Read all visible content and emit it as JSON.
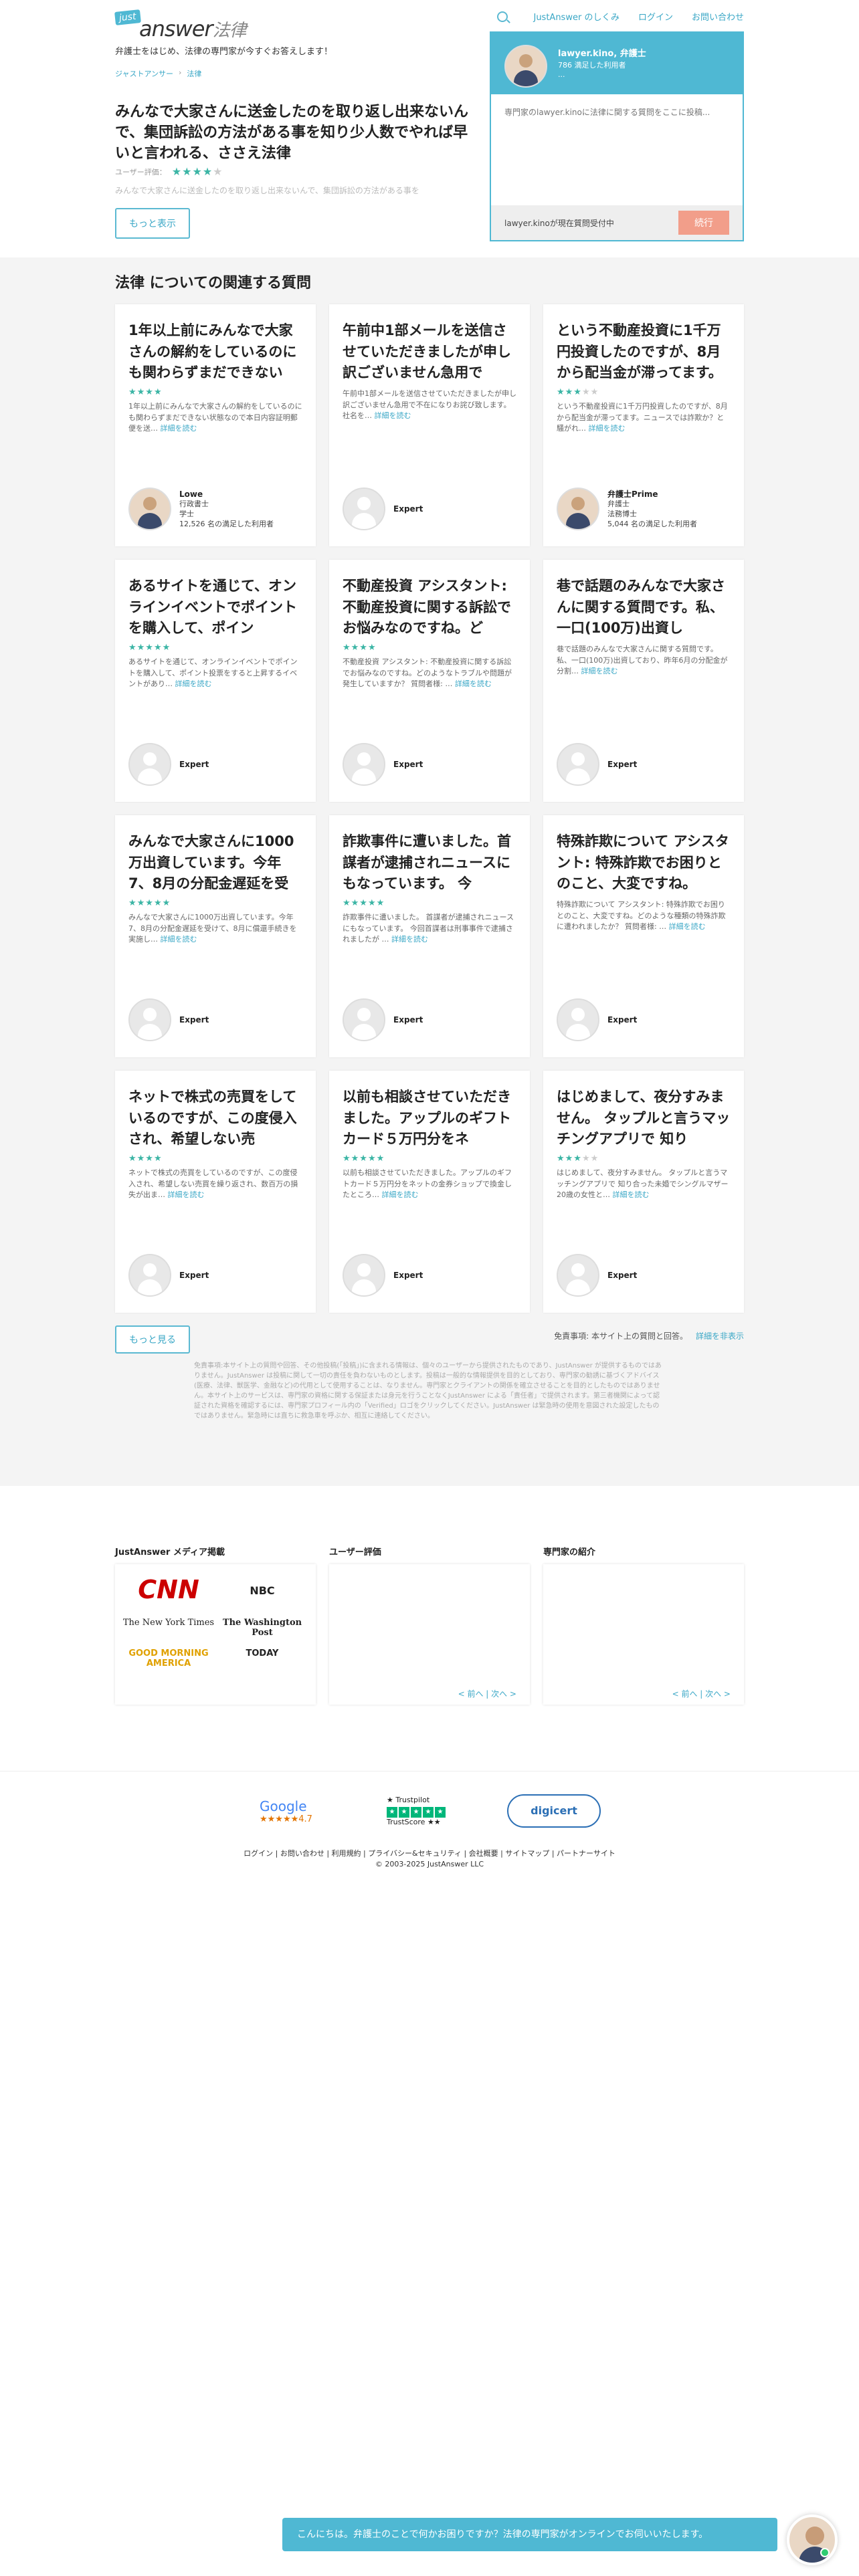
{
  "header": {
    "logo_just": "just",
    "logo_answer": "answer",
    "logo_sub": "法律",
    "tagline": "弁護士をはじめ、法律の専門家が今すぐお答えします！",
    "nav": [
      "JustAnswer のしくみ",
      "ログイン",
      "お問い合わせ"
    ]
  },
  "breadcrumb": [
    "ジャストアンサー",
    "法律"
  ],
  "question": {
    "title": "みんなで大家さんに送金したのを取り返し出来ないんで、集団訴訟の方法がある事を知り少人数でやれば早いと言われる、ささえ法律",
    "rating_label": "ユーザー評価：",
    "stars_on": "★★★★",
    "stars_off": "★",
    "preview": "みんなで大家さんに送金したのを取り返し出来ないんで、集団訴訟の方法がある事を",
    "more_button": "もっと表示"
  },
  "chat_widget": {
    "expert_name": "lawyer.kino, 弁護士",
    "satisfied": "786 満足した利用者",
    "dots": "...",
    "placeholder": "専門家のlawyer.kinoに法律に関する質問をここに投稿...",
    "status": "lawyer.kinoが現在質問受付中",
    "continue": "続行"
  },
  "related": {
    "title": "法律 についての関連する質問",
    "read_more": "詳細を読む",
    "cards": [
      {
        "title": "1年以上前にみんなで大家さんの解約をしているのにも関わらずまだできない",
        "stars_on": "★★★★",
        "stars_off": "",
        "desc": "1年以上前にみんなで大家さんの解約をしているのにも関わらずまだできない状態なので本日内容証明郵便を送…",
        "expert": "Lowe",
        "role1": "行政書士",
        "role2": "学士",
        "count": "12,526 名の満足した利用者",
        "photo": true
      },
      {
        "title": "午前中1部メールを送信させていただきましたが申し訳ございません急用で",
        "stars_on": "",
        "stars_off": "",
        "desc": "午前中1部メールを送信させていただきましたが申し訳ございません急用で不在になりお詫び致します。社名を…",
        "expert": "Expert",
        "role1": "",
        "role2": "",
        "count": "",
        "photo": false
      },
      {
        "title": "という不動産投資に1千万円投資したのですが、8月から配当金が滞ってます。",
        "stars_on": "★★★",
        "stars_off": "★★",
        "desc": "という不動産投資に1千万円投資したのですが、8月から配当金が滞ってます。ニュースでは詐欺か？と騒がれ…",
        "expert": "弁護士Prime",
        "role1": "弁護士",
        "role2": "法務博士",
        "count": "5,044 名の満足した利用者",
        "photo": true
      },
      {
        "title": "あるサイトを通じて、オンラインイベントでポイントを購入して、ポイン",
        "stars_on": "★★★★★",
        "stars_off": "",
        "desc": "あるサイトを通じて、オンラインイベントでポイントを購入して、ポイント投票をすると上昇するイベントがあり…",
        "expert": "Expert",
        "role1": "",
        "role2": "",
        "count": "",
        "photo": false
      },
      {
        "title": "不動産投資 アシスタント: 不動産投資に関する訴訟でお悩みなのですね。ど",
        "stars_on": "★★★★",
        "stars_off": "",
        "desc": "不動産投資 アシスタント: 不動産投資に関する訴訟でお悩みなのですね。どのようなトラブルや問題が発生していますか？ 質問者様: …",
        "expert": "Expert",
        "role1": "",
        "role2": "",
        "count": "",
        "photo": false
      },
      {
        "title": "巷で話題のみんなで大家さんに関する質問です。私、一口(100万)出資し",
        "stars_on": "",
        "stars_off": "",
        "desc": "巷で話題のみんなで大家さんに関する質問です。私、一口(100万)出資しており、昨年6月の分配金が分割…",
        "expert": "Expert",
        "role1": "",
        "role2": "",
        "count": "",
        "photo": false
      },
      {
        "title": "みんなで大家さんに1000万出資しています。今年7、8月の分配金遅延を受",
        "stars_on": "★★★★★",
        "stars_off": "",
        "desc": "みんなで大家さんに1000万出資しています。今年7、8月の分配金遅延を受けて、8月に償還手続きを実施し…",
        "expert": "Expert",
        "role1": "",
        "role2": "",
        "count": "",
        "photo": false
      },
      {
        "title": "詐欺事件に遭いました。首謀者が逮捕されニュースにもなっています。 今",
        "stars_on": "★★★★★",
        "stars_off": "",
        "desc": "詐欺事件に遭いました。 首謀者が逮捕されニュースにもなっています。 今回首謀者は刑事事件で逮捕されましたが …",
        "expert": "Expert",
        "role1": "",
        "role2": "",
        "count": "",
        "photo": false
      },
      {
        "title": "特殊詐欺について アシスタント: 特殊詐欺でお困りとのこと、大変ですね。",
        "stars_on": "",
        "stars_off": "",
        "desc": "特殊詐欺について アシスタント: 特殊詐欺でお困りとのこと、大変ですね。どのような種類の特殊詐欺に遭われましたか？ 質問者様: …",
        "expert": "Expert",
        "role1": "",
        "role2": "",
        "count": "",
        "photo": false
      },
      {
        "title": "ネットで株式の売買をしているのですが、この度侵入され、希望しない売",
        "stars_on": "★★★★",
        "stars_off": "",
        "desc": "ネットで株式の売買をしているのですが、この度侵入され、希望しない売買を繰り返され、数百万の損失が出ま…",
        "expert": "Expert",
        "role1": "",
        "role2": "",
        "count": "",
        "photo": false
      },
      {
        "title": "以前も相談させていただきました。アップルのギフトカード５万円分をネ",
        "stars_on": "★★★★★",
        "stars_off": "",
        "desc": "以前も相談させていただきました。アップルのギフトカード５万円分をネットの金券ショップで換金したところ…",
        "expert": "Expert",
        "role1": "",
        "role2": "",
        "count": "",
        "photo": false
      },
      {
        "title": "はじめまして、夜分すみません。 タップルと言うマッチングアプリで 知り",
        "stars_on": "★★★",
        "stars_off": "★★",
        "desc": "はじめまして、夜分すみません。 タップルと言うマッチングアプリで 知り合った未婚でシングルマザー20歳の女性と…",
        "expert": "Expert",
        "role1": "",
        "role2": "",
        "count": "",
        "photo": false
      }
    ],
    "more_button": "もっと見る",
    "disclaimer_short": "免責事項: 本サイト上の質問と回答。",
    "disclaimer_link": "詳細を非表示",
    "disclaimer_long": "免責事項:本サイト上の質問や回答、その他投稿(「投稿」)に含まれる情報は、個々のユーザーから提供されたものであり、JustAnswer が提供するものではありません。JustAnswer は投稿に関して一切の責任を負わないものとします。投稿は一般的な情報提供を目的としており、専門家の勧誘に基づくアドバイス(医療、法律、獣医学、金融など)の代用として使用することは、なりません。専門家とクライアントの関係を確立させることを目的としたものではありません。本サイト上のサービスは、専門家の資格に関する保証または身元を行うことなくJustAnswer による「責任者」で提供されます。第三者機関によって認証された資格を確認するには、専門家プロフィール内の「Verified」ロゴをクリックしてください。JustAnswer は緊急時の使用を意図された設定したものではありません。緊急時には直ちに救急車を呼ぶか、相互に連絡してください。"
  },
  "media": {
    "title": "JustAnswer メディア掲載",
    "logos": [
      "CNN",
      "NBC",
      "The New York Times",
      "The Washington Post",
      "GOOD MORNING AMERICA",
      "TODAY"
    ]
  },
  "reviews": {
    "title": "ユーザー評価",
    "pager": "< 前へ | 次へ >"
  },
  "experts": {
    "title": "専門家の紹介",
    "pager": "< 前へ | 次へ >"
  },
  "footer": {
    "google": "Google",
    "google_score": "★★★★★4.7",
    "trustpilot": "★ Trustpilot",
    "trustpilot_tag": "TrustScore ★★",
    "digicert": "digicert",
    "links": "ログイン | お問い合わせ | 利用規約 | プライバシー&セキュリティ | 会社概要 | サイトマップ | パートナーサイト",
    "copyright": "© 2003-2025 JustAnswer LLC"
  },
  "chat_prompt": "こんにちは。弁護士のことで何かお困りですか？法律の専門家がオンラインでお伺いいたします。",
  "colors": {
    "accent": "#4fb8d3",
    "stars": "#3bb5a5",
    "continue": "#f29e8a"
  }
}
